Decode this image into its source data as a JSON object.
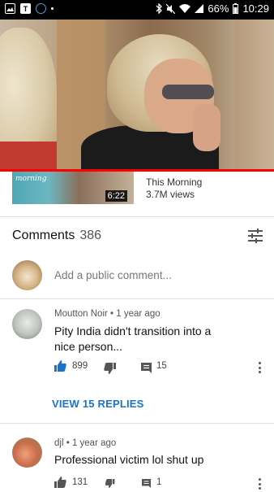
{
  "status_bar": {
    "battery": "66%",
    "time": "10:29",
    "left_icons": [
      "gallery-icon",
      "tumblr-icon",
      "sync-icon",
      "dot-icon"
    ],
    "right_icons": [
      "bluetooth-icon",
      "mute-icon",
      "wifi-icon",
      "signal-icon",
      "battery-icon"
    ]
  },
  "video": {
    "progress_fraction": 1.0
  },
  "related": {
    "thumb_text": "morning",
    "duration": "6:22",
    "channel": "This Morning",
    "views": "3.7M views"
  },
  "comments": {
    "title": "Comments",
    "count": "386",
    "add_placeholder": "Add a public comment...",
    "items": [
      {
        "author": "Moutton Noir",
        "time": "1 year ago",
        "text_line1": "Pity India didn't transition into a",
        "text_line2": "nice person...",
        "likes": "899",
        "replies": "15",
        "view_replies": "VIEW 15 REPLIES"
      },
      {
        "author": "djl",
        "time": "1 year ago",
        "text_line1": "Professional victim lol shut up",
        "likes": "131",
        "replies": "1"
      }
    ]
  },
  "colors": {
    "accent_blue": "#1a73c8",
    "progress_red": "#ff0000"
  }
}
